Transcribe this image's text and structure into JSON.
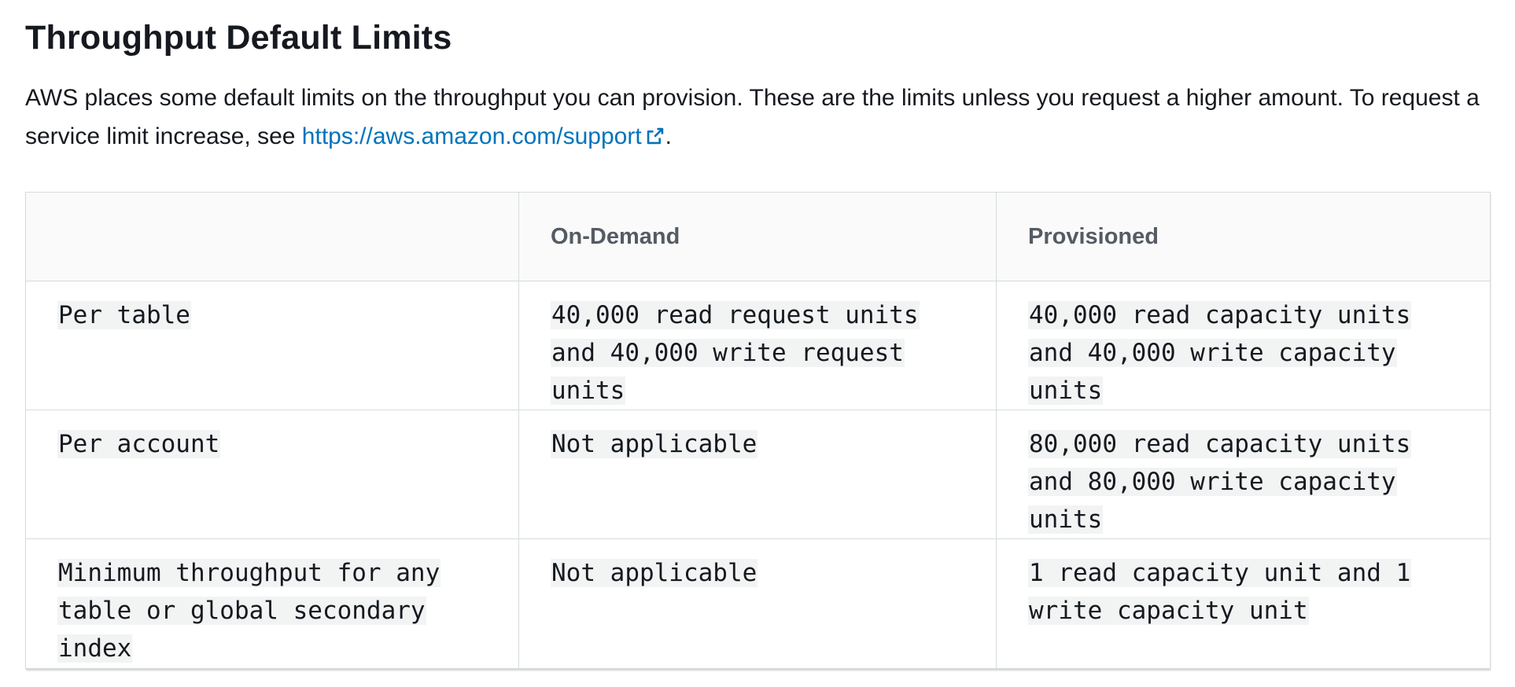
{
  "page": {
    "title": "Throughput Default Limits",
    "intro_text": "AWS places some default limits on the throughput you can provision. These are the limits unless you request a higher amount. To request a service limit increase, see ",
    "link_text": "https://aws.amazon.com/support",
    "link_icon": "external-link-icon",
    "trailing_text": "."
  },
  "table": {
    "headers": [
      "",
      "On-Demand",
      "Provisioned"
    ],
    "rows": [
      {
        "label": "Per table",
        "on_demand": "40,000 read request units and 40,000 write request units",
        "provisioned": "40,000 read capacity units and 40,000 write capacity units"
      },
      {
        "label": "Per account",
        "on_demand": "Not applicable",
        "provisioned": "80,000 read capacity units and 80,000 write capacity units"
      },
      {
        "label": "Minimum throughput for any table or global secondary index",
        "on_demand": "Not applicable",
        "provisioned": "1 read capacity unit and 1 write capacity unit"
      }
    ]
  },
  "colors": {
    "link": "#0073bb",
    "header_text": "#545b64",
    "code_background": "#f2f3f3",
    "border": "#d5dbdb"
  }
}
